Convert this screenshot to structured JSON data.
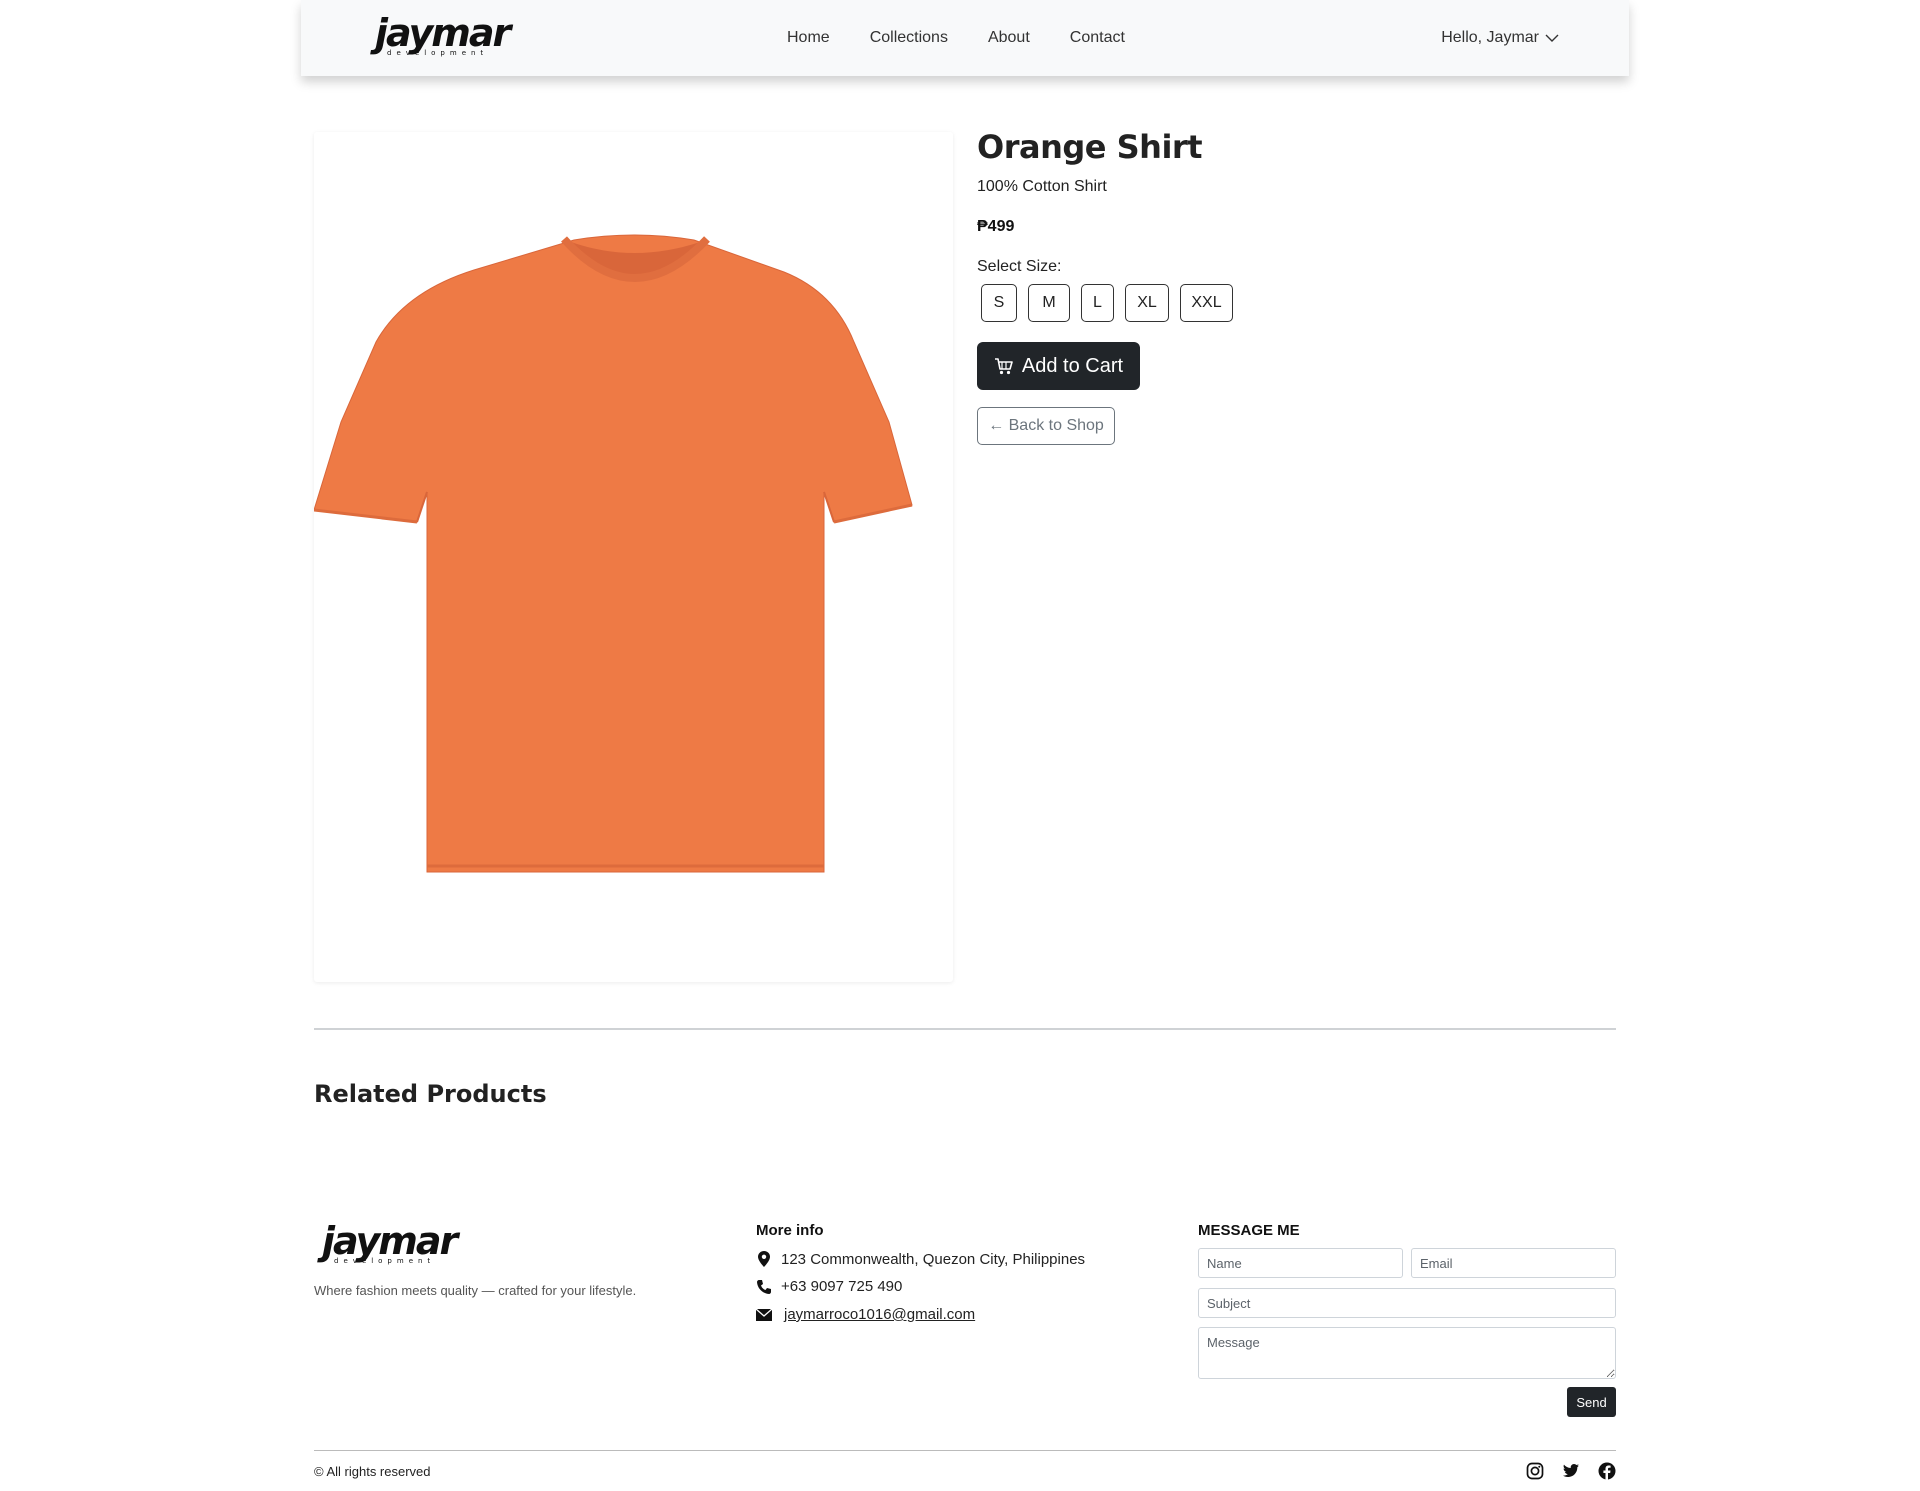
{
  "brand": {
    "logo_word": "jaymar",
    "logo_sub": "development"
  },
  "nav": {
    "links": [
      "Home",
      "Collections",
      "About",
      "Contact"
    ],
    "user_greeting": "Hello, Jaymar"
  },
  "product": {
    "name": "Orange Shirt",
    "description": "100% Cotton Shirt",
    "price": "₱499",
    "size_label": "Select Size:",
    "sizes": [
      "S",
      "M",
      "L",
      "XL",
      "XXL"
    ],
    "add_to_cart": "Add to Cart",
    "back_to_shop": "← Back to Shop",
    "shirt_color": "#ee7a45"
  },
  "related": {
    "title": "Related Products"
  },
  "footer": {
    "tagline": "Where fashion meets quality — crafted for your lifestyle.",
    "more_info": {
      "title": "More info",
      "address": "123 Commonwealth, Quezon City, Philippines",
      "phone": "+63 9097 725 490",
      "email": "jaymarroco1016@gmail.com"
    },
    "message": {
      "title": "MESSAGE ME",
      "name_placeholder": "Name",
      "email_placeholder": "Email",
      "subject_placeholder": "Subject",
      "message_placeholder": "Message",
      "send_label": "Send"
    },
    "copyright": "© All rights reserved",
    "socials": [
      "instagram-icon",
      "twitter-icon",
      "facebook-icon"
    ]
  },
  "colors": {
    "primary_dark": "#212529",
    "navbar_bg": "#f8f9fa"
  }
}
